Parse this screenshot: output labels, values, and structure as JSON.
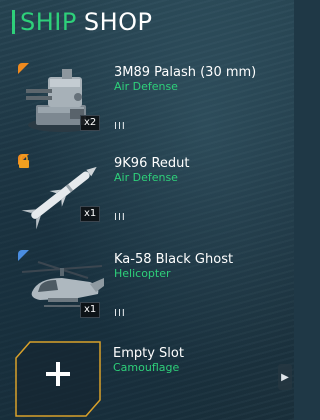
{
  "header": {
    "title_part1": "SHIP",
    "title_part2": "SHOP"
  },
  "items": [
    {
      "name": "3M89 Palash (30 mm)",
      "category": "Air Defense",
      "quantity": "x2",
      "tier": "III",
      "rarity_color": "#f08a1e",
      "icon": "turret-icon",
      "locked": false
    },
    {
      "name": "9K96 Redut",
      "category": "Air Defense",
      "quantity": "x1",
      "tier": "III",
      "rarity_color": "#f08a1e",
      "icon": "missile-icon",
      "locked": true
    },
    {
      "name": "Ka-58 Black Ghost",
      "category": "Helicopter",
      "quantity": "x1",
      "tier": "III",
      "rarity_color": "#4a8de0",
      "icon": "helicopter-icon",
      "locked": false
    }
  ],
  "empty_slot": {
    "name": "Empty Slot",
    "category": "Camouflage",
    "border_color": "#d9a12a"
  },
  "accent": "#2ed07a"
}
